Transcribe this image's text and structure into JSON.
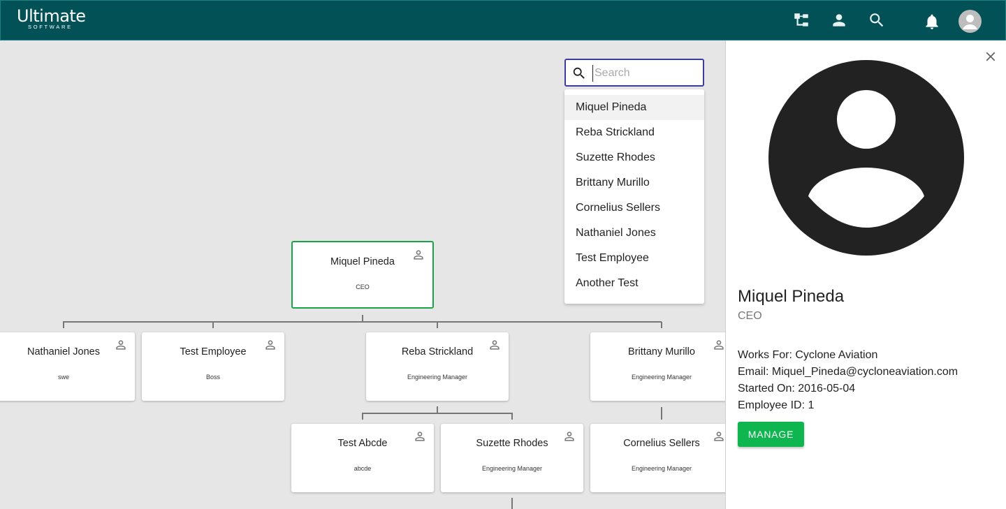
{
  "header": {
    "logo_main": "Ultimate",
    "logo_sub": "SOFTWARE",
    "icons": [
      "org-chart-icon",
      "person-icon",
      "search-icon",
      "notifications-icon",
      "account-avatar"
    ]
  },
  "search": {
    "placeholder": "Search",
    "value": "",
    "suggestions": [
      "Miquel Pineda",
      "Reba Strickland",
      "Suzette Rhodes",
      "Brittany Murillo",
      "Cornelius Sellers",
      "Nathaniel Jones",
      "Test Employee",
      "Another Test"
    ]
  },
  "chart": {
    "root": {
      "name": "Miquel Pineda",
      "title": "CEO"
    },
    "level1": [
      {
        "name": "Nathaniel Jones",
        "title": "swe"
      },
      {
        "name": "Test Employee",
        "title": "Boss"
      },
      {
        "name": "Reba Strickland",
        "title": "Engineering Manager"
      },
      {
        "name": "Brittany Murillo",
        "title": "Engineering Manager"
      }
    ],
    "level2": [
      {
        "name": "Test Abcde",
        "title": "abcde"
      },
      {
        "name": "Suzette Rhodes",
        "title": "Engineering Manager"
      },
      {
        "name": "Cornelius Sellers",
        "title": "Engineering Manager"
      }
    ]
  },
  "detail": {
    "name": "Miquel Pineda",
    "title": "CEO",
    "works_for": "Works For: Cyclone Aviation",
    "email": "Email: Miquel_Pineda@cycloneaviation.com",
    "started_on": "Started On: 2016-05-04",
    "employee_id": "Employee ID: 1",
    "manage_label": "MANAGE"
  },
  "colors": {
    "header_bg": "#025157",
    "accent_green": "#0fb64f",
    "selected_border": "#19a448",
    "search_border": "#3c3c9c"
  }
}
